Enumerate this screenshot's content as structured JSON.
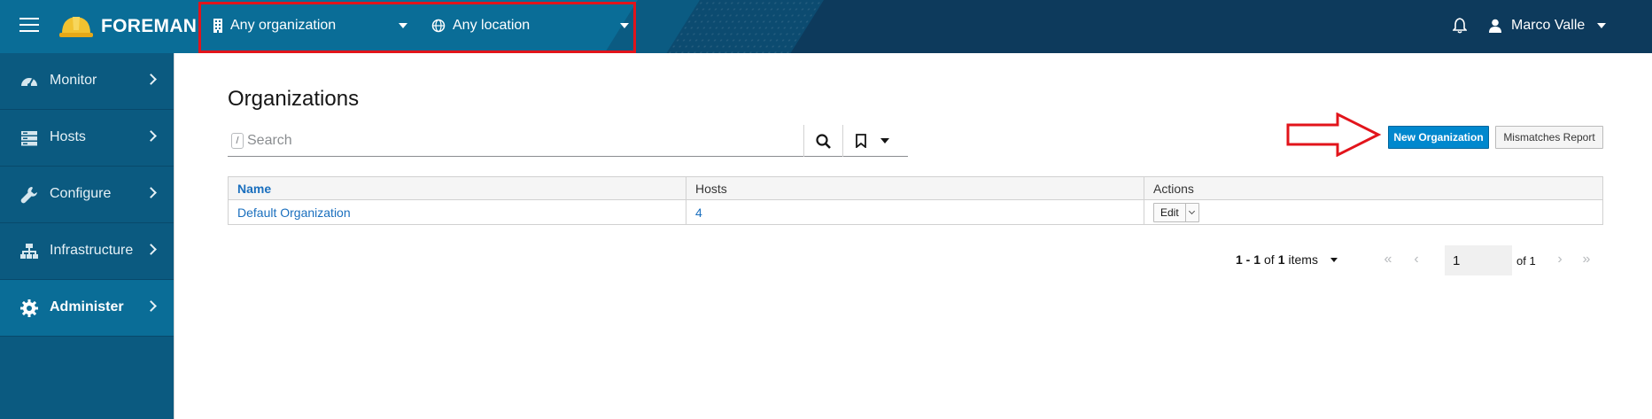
{
  "header": {
    "app_name": "FOREMAN",
    "organization": "Any organization",
    "location": "Any location",
    "user_name": "Marco Valle"
  },
  "sidebar": {
    "items": [
      {
        "label": "Monitor",
        "icon": "dashboard-icon"
      },
      {
        "label": "Hosts",
        "icon": "server-icon"
      },
      {
        "label": "Configure",
        "icon": "wrench-icon"
      },
      {
        "label": "Infrastructure",
        "icon": "network-icon"
      },
      {
        "label": "Administer",
        "icon": "gear-icon",
        "active": true
      }
    ]
  },
  "main": {
    "title": "Organizations",
    "search": {
      "placeholder": "Search",
      "shortcut": "/"
    },
    "buttons": {
      "new_organization": "New Organization",
      "mismatches_report": "Mismatches Report"
    },
    "table": {
      "headers": [
        "Name",
        "Hosts",
        "Actions"
      ],
      "rows": [
        {
          "name": "Default Organization",
          "hosts": "4",
          "action": "Edit"
        }
      ]
    },
    "pagination": {
      "range": "1 - 1",
      "of_word": "of",
      "total": "1",
      "items_word": "items",
      "page": "1",
      "page_of": "of 1"
    }
  },
  "colors": {
    "accent": "#0088ce",
    "header": "#0a6d97",
    "annotation": "#e2141b"
  }
}
